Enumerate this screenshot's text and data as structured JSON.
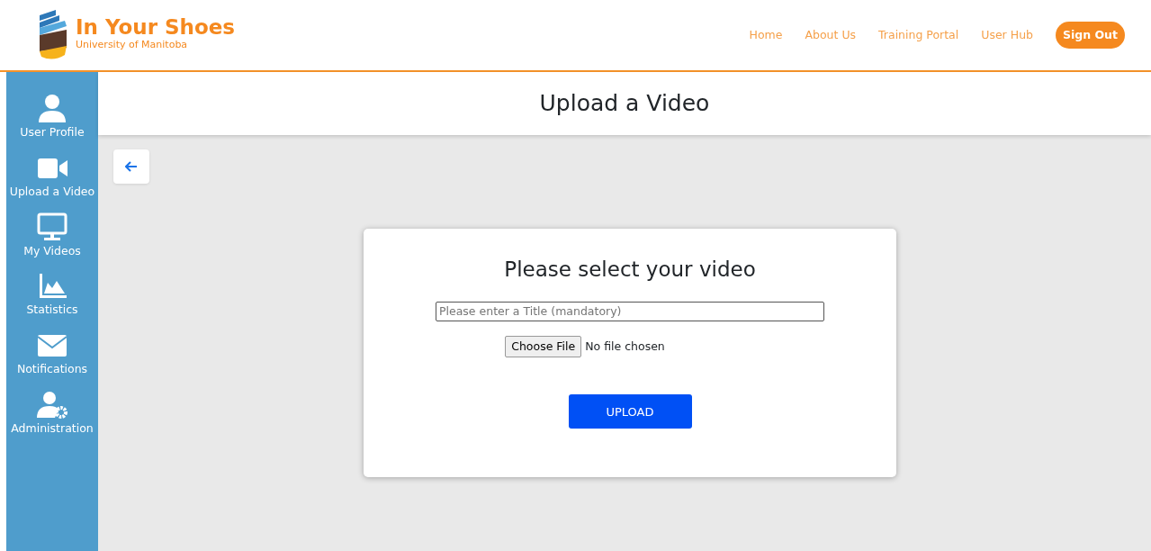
{
  "brand": {
    "title": "In Your Shoes",
    "subtitle": "University of Manitoba"
  },
  "nav": {
    "links": [
      "Home",
      "About Us",
      "Training Portal",
      "User Hub"
    ],
    "button": "Sign Out"
  },
  "sidebar": {
    "items": [
      {
        "label": "User Profile"
      },
      {
        "label": "Upload a Video"
      },
      {
        "label": "My Videos"
      },
      {
        "label": "Statistics"
      },
      {
        "label": "Notifications"
      },
      {
        "label": "Administration"
      }
    ]
  },
  "page_title": "Upload a Video",
  "form": {
    "heading": "Please select your video",
    "title_field": {
      "placeholder": "Please enter a Title (mandatory)"
    },
    "file_button": "Choose File",
    "file_status": "No file chosen",
    "submit": "UPLOAD"
  }
}
